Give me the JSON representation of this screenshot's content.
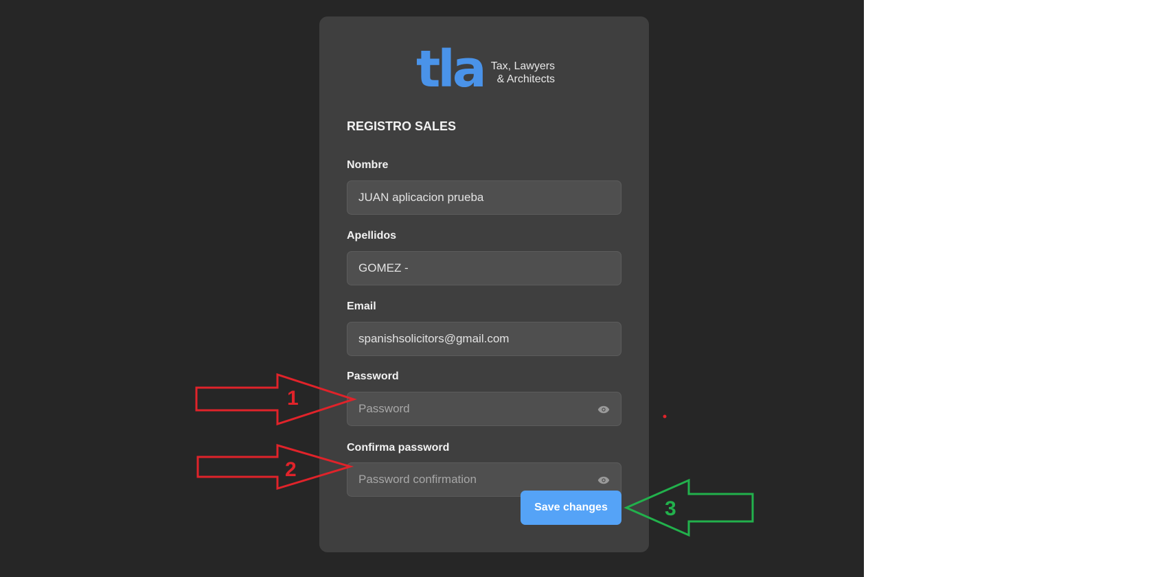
{
  "logo": {
    "mark": "tla",
    "line1": "Tax, Lawyers",
    "line2": "& Architects"
  },
  "form": {
    "title": "REGISTRO SALES",
    "fields": [
      {
        "label": "Nombre",
        "value": "JUAN aplicacion prueba",
        "placeholder": ""
      },
      {
        "label": "Apellidos",
        "value": "GOMEZ -",
        "placeholder": ""
      },
      {
        "label": "Email",
        "value": "spanishsolicitors@gmail.com",
        "placeholder": ""
      },
      {
        "label": "Password",
        "value": "",
        "placeholder": "Password",
        "icon": "eye-icon"
      },
      {
        "label": "Confirma password",
        "value": "",
        "placeholder": "Password confirmation",
        "icon": "eye-icon"
      }
    ],
    "save_label": "Save changes"
  },
  "annotations": {
    "arrow1_label": "1",
    "arrow2_label": "2",
    "arrow3_label": "3"
  },
  "colors": {
    "background": "#262626",
    "card": "#3f3f3f",
    "input": "#4f4f4f",
    "accent": "#55a3f7",
    "logo": "#4a93e9",
    "arrow_red": "#e0232a",
    "arrow_green": "#22b14c"
  }
}
